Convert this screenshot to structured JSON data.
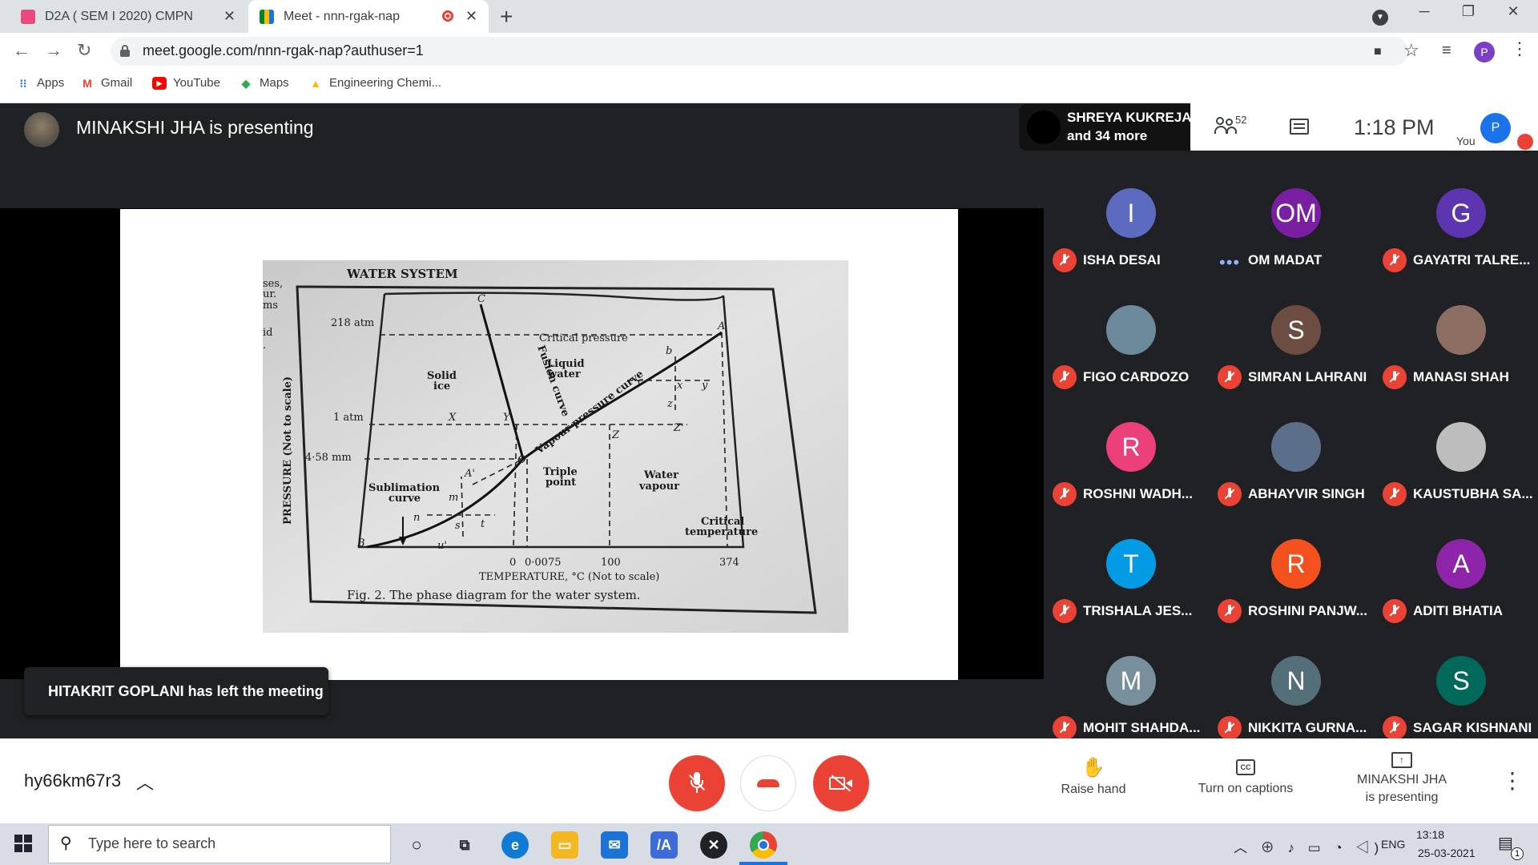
{
  "browser": {
    "tabs": [
      {
        "title": "D2A ( SEM I 2020) CMPN",
        "close": "✕"
      },
      {
        "title": "Meet - nnn-rgak-nap",
        "close": "✕"
      }
    ],
    "new_tab": "+",
    "url": "meet.google.com/nnn-rgak-nap?authuser=1",
    "profile_initial": "P",
    "bookmarks": [
      "Apps",
      "Gmail",
      "YouTube",
      "Maps",
      "Engineering Chemi..."
    ]
  },
  "meet": {
    "presenting_title": "MINAKSHI JHA is presenting",
    "people_chip": {
      "name": "SHREYA KUKREJA",
      "more": "and 34 more"
    },
    "people_count": "52",
    "clock": "1:18 PM",
    "self": {
      "initial": "P",
      "label": "You"
    },
    "toast": "HITAKRIT GOPLANI has left the meeting",
    "participants": [
      {
        "name": "ISHA DESAI",
        "initial": "I",
        "color": "#5c6bc0",
        "status": "muted"
      },
      {
        "name": "OM MADAT",
        "initial": "OM",
        "color": "#7b1fa2",
        "status": "speaking"
      },
      {
        "name": "GAYATRI TALRE...",
        "initial": "G",
        "color": "#5e35b1",
        "status": "muted"
      },
      {
        "name": "FIGO CARDOZO",
        "initial": "",
        "color": "#6d8a9c",
        "status": "muted"
      },
      {
        "name": "SIMRAN LAHRANI",
        "initial": "S",
        "color": "#6d4c41",
        "status": "muted"
      },
      {
        "name": "MANASI SHAH",
        "initial": "",
        "color": "#8d6e63",
        "status": "muted"
      },
      {
        "name": "ROSHNI WADH...",
        "initial": "R",
        "color": "#ec407a",
        "status": "muted"
      },
      {
        "name": "ABHAYVIR SINGH",
        "initial": "",
        "color": "#5b6f8a",
        "status": "muted"
      },
      {
        "name": "KAUSTUBHA SA...",
        "initial": "",
        "color": "#bdbdbd",
        "status": "muted"
      },
      {
        "name": "TRISHALA JES...",
        "initial": "T",
        "color": "#039be5",
        "status": "muted"
      },
      {
        "name": "ROSHINI PANJW...",
        "initial": "R",
        "color": "#f4511e",
        "status": "muted"
      },
      {
        "name": "ADITI BHATIA",
        "initial": "A",
        "color": "#8e24aa",
        "status": "muted"
      },
      {
        "name": "MOHIT SHAHDA...",
        "initial": "M",
        "color": "#78909c",
        "status": "muted"
      },
      {
        "name": "NIKKITA GURNA...",
        "initial": "N",
        "color": "#546e7a",
        "status": "muted"
      },
      {
        "name": "SAGAR KISHNANI",
        "initial": "S",
        "color": "#00695c",
        "status": "muted"
      }
    ],
    "bottom": {
      "meeting_code": "hy66km67r3",
      "raise_hand": "Raise hand",
      "captions": "Turn on captions",
      "presenting_line1": "MINAKSHI JHA",
      "presenting_line2": "is presenting"
    }
  },
  "slide": {
    "heading": "WATER SYSTEM",
    "left_margin_text": [
      "ses,",
      "ur.",
      "ms",
      "id",
      "."
    ],
    "pressure_axis": "PRESSURE (Not to scale)",
    "pressure_ticks": [
      "218 atm",
      "1 atm",
      "4·58 mm"
    ],
    "regions": {
      "solid_1": "Solid",
      "solid_2": "ice",
      "liquid_1": "Liquid",
      "liquid_2": "water",
      "vapour_1": "Water",
      "vapour_2": "vapour"
    },
    "curves": {
      "critical_pressure": "Critical pressure",
      "fusion": "Fusion curve",
      "vapour_pressure": "Vapour pressure curve",
      "sublimation_1": "Sublimation",
      "sublimation_2": "curve",
      "triple_1": "Triple",
      "triple_2": "point",
      "critical_temp_1": "Critical",
      "critical_temp_2": "temperature"
    },
    "point_labels": {
      "C": "C",
      "A": "A",
      "B": "B",
      "O": "O",
      "X": "X",
      "Y": "Y",
      "Z": "Z",
      "Zp": "Z'",
      "Ap": "A'",
      "b": "b",
      "c": "c",
      "x": "x",
      "y": "y",
      "z": "z",
      "m": "m",
      "n": "n",
      "s": "s",
      "t": "t",
      "u": "u'"
    },
    "temp_ticks": [
      "0",
      "0·0075",
      "100",
      "374"
    ],
    "temp_axis": "TEMPERATURE, °C (Not to scale)",
    "caption": "Fig. 2.  The phase diagram for the water system."
  },
  "taskbar": {
    "search_placeholder": "Type here to search",
    "time": "13:18",
    "date": "25-03-2021",
    "lang": "ENG",
    "notification_count": "1"
  },
  "colors": {
    "meet_red": "#ea4335",
    "meet_bg": "#202124",
    "accent_blue": "#1a73e8"
  }
}
